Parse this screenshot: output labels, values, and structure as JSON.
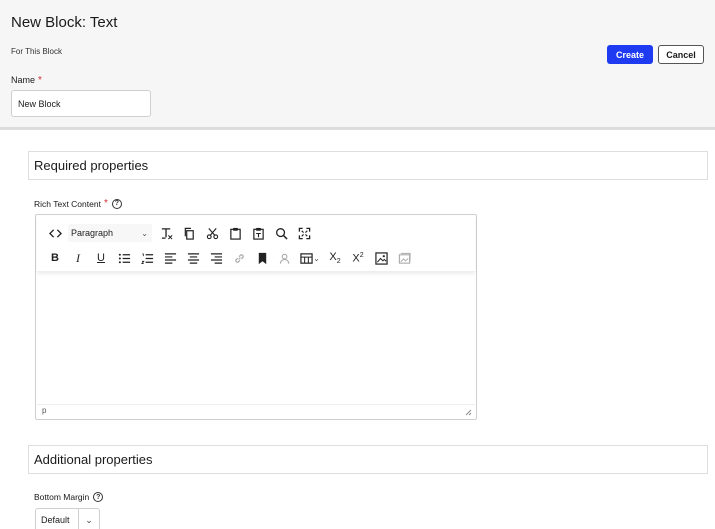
{
  "header": {
    "title": "New Block: Text",
    "subtitle": "For This Block",
    "create_label": "Create",
    "cancel_label": "Cancel",
    "name_label": "Name",
    "required_mark": "*",
    "name_value": "New Block"
  },
  "sections": {
    "required_title": "Required properties",
    "additional_title": "Additional properties"
  },
  "rich_text": {
    "label": "Rich Text Content",
    "required_mark": "*",
    "help": "?",
    "format_select": "Paragraph",
    "status_path": "p",
    "content": ""
  },
  "bottom_margin": {
    "label": "Bottom Margin",
    "help": "?",
    "value": "Default"
  },
  "colors": {
    "accent": "#1f3bf2",
    "required": "#d32f2f",
    "header_bg": "#f6f6f7"
  }
}
